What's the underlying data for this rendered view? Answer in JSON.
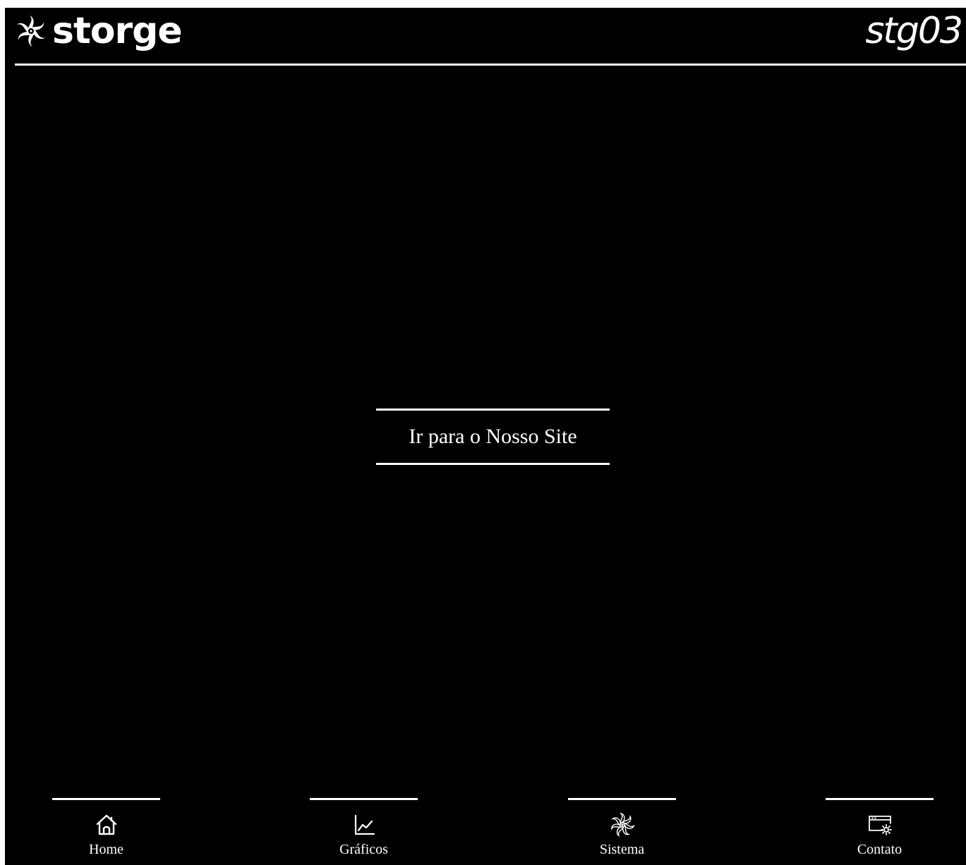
{
  "header": {
    "brand_name": "storge",
    "brand_icon": "fan-logo-icon",
    "version_label": "stg03"
  },
  "main": {
    "cta_label": "Ir para o Nosso Site"
  },
  "nav": {
    "items": [
      {
        "label": "Home",
        "icon": "home-icon"
      },
      {
        "label": "Gráficos",
        "icon": "chart-line-icon"
      },
      {
        "label": "Sistema",
        "icon": "fan-icon"
      },
      {
        "label": "Contato",
        "icon": "window-gear-icon"
      }
    ]
  },
  "colors": {
    "background": "#000000",
    "foreground": "#ffffff"
  }
}
